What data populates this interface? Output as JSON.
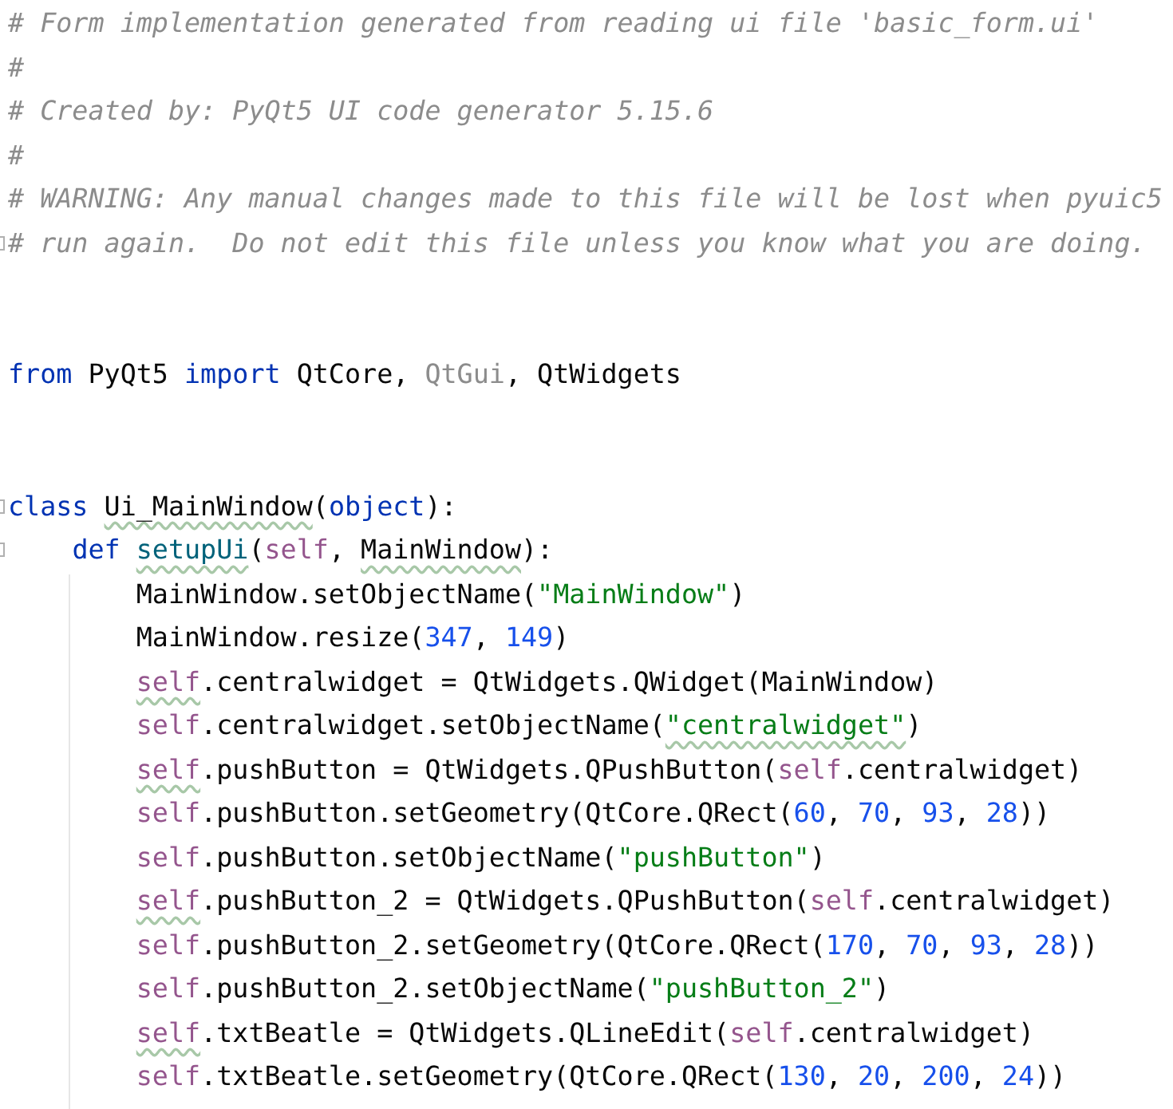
{
  "lines": [
    {
      "kind": "code",
      "tokens": [
        {
          "text": "# Form implementation generated from reading ui file 'basic_form.ui'",
          "kind": "comment"
        }
      ]
    },
    {
      "kind": "code",
      "tokens": [
        {
          "text": "#",
          "kind": "comment"
        }
      ]
    },
    {
      "kind": "code",
      "tokens": [
        {
          "text": "# Created by: PyQt5 UI code generator 5.15.6",
          "kind": "comment"
        }
      ]
    },
    {
      "kind": "code",
      "tokens": [
        {
          "text": "#",
          "kind": "comment"
        }
      ]
    },
    {
      "kind": "code",
      "tokens": [
        {
          "text": "# WARNING: Any manual changes made to this file will be lost when pyuic5",
          "kind": "comment"
        }
      ]
    },
    {
      "kind": "code",
      "fold": true,
      "tokens": [
        {
          "text": "# run again.  Do not edit this file unless you know what you are doing.",
          "kind": "comment"
        }
      ]
    },
    {
      "kind": "blank"
    },
    {
      "kind": "blank"
    },
    {
      "kind": "code",
      "tokens": [
        {
          "text": "from",
          "kind": "keyword"
        },
        {
          "text": " PyQt5 ",
          "kind": "plain"
        },
        {
          "text": "import",
          "kind": "keyword"
        },
        {
          "text": " QtCore, ",
          "kind": "plain"
        },
        {
          "text": "QtGui",
          "kind": "unused"
        },
        {
          "text": ", QtWidgets",
          "kind": "plain"
        }
      ]
    },
    {
      "kind": "blank"
    },
    {
      "kind": "blank"
    },
    {
      "kind": "code",
      "fold": true,
      "tokens": [
        {
          "text": "class",
          "kind": "keyword"
        },
        {
          "text": " Ui_MainWindow",
          "kind": "plain",
          "typo": true
        },
        {
          "text": "(",
          "kind": "plain"
        },
        {
          "text": "object",
          "kind": "keyword"
        },
        {
          "text": "):",
          "kind": "plain"
        }
      ]
    },
    {
      "kind": "code",
      "fold": true,
      "tokens": [
        {
          "text": "    def",
          "kind": "keyword"
        },
        {
          "text": " setupUi",
          "kind": "function",
          "typo": true
        },
        {
          "text": "(",
          "kind": "plain"
        },
        {
          "text": "self",
          "kind": "self"
        },
        {
          "text": ",",
          "kind": "plain"
        },
        {
          "text": " MainWindow",
          "kind": "plain",
          "typo": true
        },
        {
          "text": "):",
          "kind": "plain"
        }
      ]
    },
    {
      "kind": "code",
      "tokens": [
        {
          "text": "        MainWindow.setObjectName(",
          "kind": "plain"
        },
        {
          "text": "\"MainWindow\"",
          "kind": "string"
        },
        {
          "text": ")",
          "kind": "plain"
        }
      ]
    },
    {
      "kind": "code",
      "tokens": [
        {
          "text": "        MainWindow.resize(",
          "kind": "plain"
        },
        {
          "text": "347",
          "kind": "number"
        },
        {
          "text": ",",
          "kind": "plain"
        },
        {
          "text": " 149",
          "kind": "number"
        },
        {
          "text": ")",
          "kind": "plain"
        }
      ]
    },
    {
      "kind": "code",
      "tokens": [
        {
          "text": "        self",
          "kind": "self",
          "typo": true
        },
        {
          "text": ".centralwidget = QtWidgets.QWidget(MainWindow)",
          "kind": "plain"
        }
      ]
    },
    {
      "kind": "code",
      "tokens": [
        {
          "text": "        self",
          "kind": "self"
        },
        {
          "text": ".centralwidget.setObjectName(",
          "kind": "plain"
        },
        {
          "text": "\"centralwidget\"",
          "kind": "string",
          "typo": true
        },
        {
          "text": ")",
          "kind": "plain"
        }
      ]
    },
    {
      "kind": "code",
      "tokens": [
        {
          "text": "        self",
          "kind": "self",
          "typo": true
        },
        {
          "text": ".pushButton = QtWidgets.QPushButton(",
          "kind": "plain"
        },
        {
          "text": "self",
          "kind": "self"
        },
        {
          "text": ".centralwidget)",
          "kind": "plain"
        }
      ]
    },
    {
      "kind": "code",
      "tokens": [
        {
          "text": "        self",
          "kind": "self"
        },
        {
          "text": ".pushButton.setGeometry(QtCore.QRect(",
          "kind": "plain"
        },
        {
          "text": "60",
          "kind": "number"
        },
        {
          "text": ",",
          "kind": "plain"
        },
        {
          "text": " 70",
          "kind": "number"
        },
        {
          "text": ",",
          "kind": "plain"
        },
        {
          "text": " 93",
          "kind": "number"
        },
        {
          "text": ",",
          "kind": "plain"
        },
        {
          "text": " 28",
          "kind": "number"
        },
        {
          "text": "))",
          "kind": "plain"
        }
      ]
    },
    {
      "kind": "code",
      "tokens": [
        {
          "text": "        self",
          "kind": "self"
        },
        {
          "text": ".pushButton.setObjectName(",
          "kind": "plain"
        },
        {
          "text": "\"pushButton\"",
          "kind": "string"
        },
        {
          "text": ")",
          "kind": "plain"
        }
      ]
    },
    {
      "kind": "code",
      "tokens": [
        {
          "text": "        self",
          "kind": "self",
          "typo": true
        },
        {
          "text": ".pushButton_2 = QtWidgets.QPushButton(",
          "kind": "plain"
        },
        {
          "text": "self",
          "kind": "self"
        },
        {
          "text": ".centralwidget)",
          "kind": "plain"
        }
      ]
    },
    {
      "kind": "code",
      "tokens": [
        {
          "text": "        self",
          "kind": "self"
        },
        {
          "text": ".pushButton_2.setGeometry(QtCore.QRect(",
          "kind": "plain"
        },
        {
          "text": "170",
          "kind": "number"
        },
        {
          "text": ",",
          "kind": "plain"
        },
        {
          "text": " 70",
          "kind": "number"
        },
        {
          "text": ",",
          "kind": "plain"
        },
        {
          "text": " 93",
          "kind": "number"
        },
        {
          "text": ",",
          "kind": "plain"
        },
        {
          "text": " 28",
          "kind": "number"
        },
        {
          "text": "))",
          "kind": "plain"
        }
      ]
    },
    {
      "kind": "code",
      "tokens": [
        {
          "text": "        self",
          "kind": "self"
        },
        {
          "text": ".pushButton_2.setObjectName(",
          "kind": "plain"
        },
        {
          "text": "\"pushButton_2\"",
          "kind": "string"
        },
        {
          "text": ")",
          "kind": "plain"
        }
      ]
    },
    {
      "kind": "code",
      "tokens": [
        {
          "text": "        self",
          "kind": "self",
          "typo": true
        },
        {
          "text": ".txtBeatle = QtWidgets.QLineEdit(",
          "kind": "plain"
        },
        {
          "text": "self",
          "kind": "self"
        },
        {
          "text": ".centralwidget)",
          "kind": "plain"
        }
      ]
    },
    {
      "kind": "code",
      "tokens": [
        {
          "text": "        self",
          "kind": "self"
        },
        {
          "text": ".txtBeatle.setGeometry(QtCore.QRect(",
          "kind": "plain"
        },
        {
          "text": "130",
          "kind": "number"
        },
        {
          "text": ",",
          "kind": "plain"
        },
        {
          "text": " 20",
          "kind": "number"
        },
        {
          "text": ",",
          "kind": "plain"
        },
        {
          "text": " 200",
          "kind": "number"
        },
        {
          "text": ",",
          "kind": "plain"
        },
        {
          "text": " 24",
          "kind": "number"
        },
        {
          "text": "))",
          "kind": "plain"
        }
      ]
    }
  ]
}
